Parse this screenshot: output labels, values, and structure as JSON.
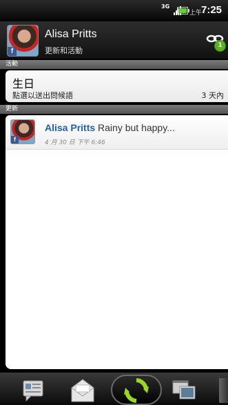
{
  "status_bar": {
    "network": "3G",
    "ampm": "上午",
    "time": "7:25"
  },
  "header": {
    "name": "Alisa Pritts",
    "subtitle": "更新和活動",
    "badge_count": "1",
    "avatar_badge": "f"
  },
  "sections": {
    "events_label": "活動",
    "updates_label": "更新"
  },
  "event": {
    "title": "生日",
    "subtitle": "點選以送出問候語",
    "when": "3 天內"
  },
  "updates": [
    {
      "name": "Alisa Pritts",
      "text": "Rainy but happy...",
      "time": "4 月 30 日 下午 6:46",
      "avatar_badge": "f"
    }
  ],
  "toolbar": {
    "items": [
      "message-icon",
      "mail-icon",
      "refresh-icon",
      "filmstrip-icon"
    ],
    "active": "refresh-icon"
  }
}
